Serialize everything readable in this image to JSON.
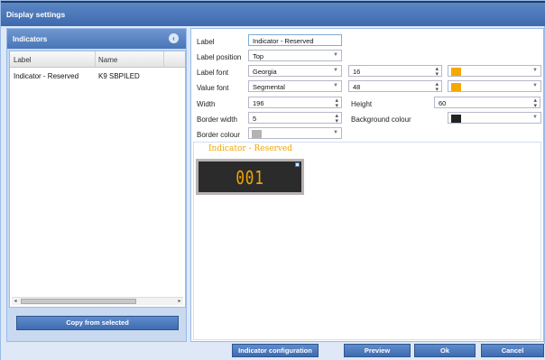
{
  "window": {
    "title": "Display settings"
  },
  "indicators_panel": {
    "title": "Indicators",
    "columns": [
      "Label",
      "Name"
    ],
    "rows": [
      {
        "label": "Indicator - Reserved",
        "name": "K9 SBPILED"
      }
    ],
    "copy_button": "Copy from selected"
  },
  "form": {
    "label": {
      "label": "Label",
      "value": "Indicator - Reserved"
    },
    "label_position": {
      "label": "Label position",
      "value": "Top"
    },
    "label_font": {
      "label": "Label font",
      "value": "Georgia",
      "size": "16",
      "color": "#f5a800"
    },
    "value_font": {
      "label": "Value font",
      "value": "Segmental",
      "size": "48",
      "color": "#f5a800"
    },
    "width": {
      "label": "Width",
      "value": "196"
    },
    "height": {
      "label": "Height",
      "value": "60"
    },
    "border_width": {
      "label": "Border width",
      "value": "5"
    },
    "background_colour": {
      "label": "Background colour",
      "color": "#222222"
    },
    "border_colour": {
      "label": "Border colour",
      "color": "#b7b2b2"
    }
  },
  "preview": {
    "label": "Indicator - Reserved",
    "value": "001"
  },
  "buttons": {
    "indicator_configuration": "Indicator configuration",
    "preview": "Preview",
    "ok": "Ok",
    "cancel": "Cancel"
  },
  "icons": {
    "collapse": "chevron-left-icon",
    "dropdown": "chevron-down-icon",
    "spinner": "up-down-icon"
  }
}
